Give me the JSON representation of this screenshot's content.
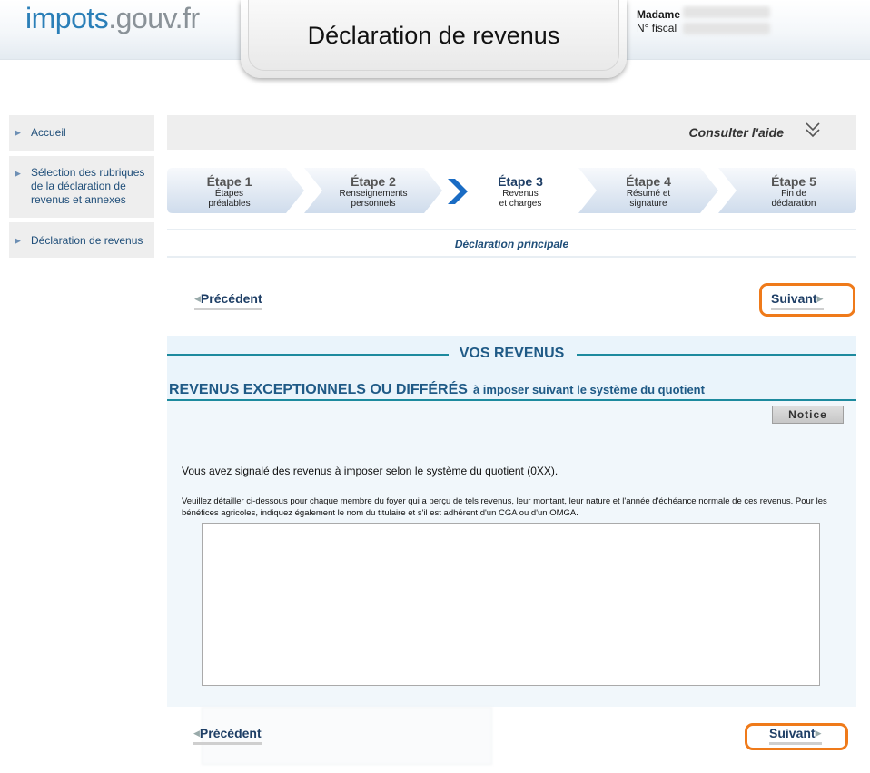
{
  "header": {
    "logo_part1": "impots",
    "logo_part2": ".gouv.fr",
    "title": "Déclaration de revenus",
    "user_salutation": "Madame",
    "user_fiscal_label": "N° fiscal"
  },
  "sidebar": {
    "items": [
      {
        "label": "Accueil"
      },
      {
        "label": "Sélection des rubriques de la déclaration de revenus et annexes"
      },
      {
        "label": "Déclaration de revenus"
      }
    ]
  },
  "help": {
    "label": "Consulter l'aide"
  },
  "steps": [
    {
      "title": "Étape 1",
      "line1": "Étapes",
      "line2": "préalables"
    },
    {
      "title": "Étape 2",
      "line1": "Renseignements",
      "line2": "personnels"
    },
    {
      "title": "Étape 3",
      "line1": "Revenus",
      "line2": "et charges"
    },
    {
      "title": "Étape 4",
      "line1": "Résumé et",
      "line2": "signature"
    },
    {
      "title": "Étape 5",
      "line1": "Fin de",
      "line2": "déclaration"
    }
  ],
  "current_step": 3,
  "subtitle": "Déclaration principale",
  "nav": {
    "previous": "Précédent",
    "next": "Suivant"
  },
  "section": {
    "title": "VOS REVENUS",
    "subsection_title": "REVENUS EXCEPTIONNELS OU DIFFÉRÉS",
    "subsection_suffix": "à imposer suivant le système du quotient",
    "notice_button": "Notice",
    "signal_text": "Vous avez signalé des revenus à imposer selon le système du quotient (0XX).",
    "detail_text": "Veuillez détailler ci-dessous pour chaque membre du foyer qui a perçu de tels revenus, leur montant, leur nature et l'année d'échéance normale de ces revenus. Pour les bénéfices agricoles, indiquez également le nom du titulaire et s'il est adhérent d'un CGA ou d'un OMGA.",
    "textarea_value": ""
  },
  "colors": {
    "accent_blue": "#1f5a86",
    "highlight_orange": "#ef7a1a",
    "panel_bg": "#eaf4fb",
    "rule_teal": "#1d8a9e"
  }
}
